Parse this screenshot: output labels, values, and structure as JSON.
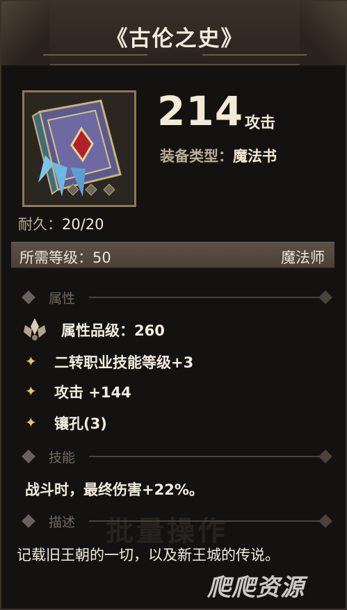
{
  "item": {
    "title": "《古伦之史》",
    "attack_value": "214",
    "attack_label": "攻击",
    "equip_type_key": "装备类型：",
    "equip_type_value": "魔法书",
    "durability_key": "耐久：",
    "durability_value": "20/20",
    "required_level_text": "所需等级：50",
    "class_requirement": "魔法师"
  },
  "sections": {
    "attributes_label": "属性",
    "skill_label": "技能",
    "description_label": "描述"
  },
  "attributes": [
    {
      "text": "属性品级：260",
      "icon": "grade-crest-icon"
    },
    {
      "text": "二转职业技能等级+3",
      "icon": "star-bullet-icon"
    },
    {
      "text": "攻击 +144",
      "icon": "star-bullet-icon"
    },
    {
      "text": "镶孔(3)",
      "icon": "star-bullet-icon"
    }
  ],
  "skill_text": "战斗时，最终伤害+22%。",
  "description_text": "记载旧王朝的一切，以及新王城的传说。",
  "watermark_text": "批量操作",
  "logo_text": "爬爬资源",
  "colors": {
    "bullet": "#e7c572",
    "frame_gold": "#8a7a55",
    "background": "#141210"
  }
}
